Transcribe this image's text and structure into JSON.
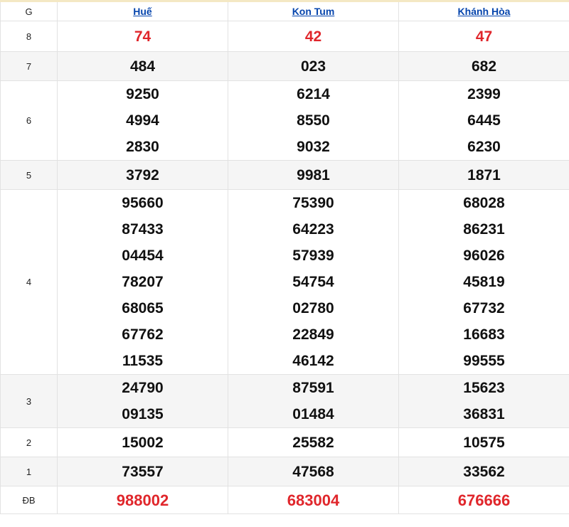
{
  "header": {
    "g_label": "G",
    "provinces": [
      "Huế",
      "Kon Tum",
      "Khánh Hòa"
    ]
  },
  "colors": {
    "accent_red": "#e0262b",
    "link_blue": "#0645ad",
    "alt_row_bg": "#f5f5f5",
    "top_border": "#f4e8c4"
  },
  "prizes": {
    "g8": {
      "label": "8",
      "values": [
        "74",
        "42",
        "47"
      ]
    },
    "g7": {
      "label": "7",
      "values": [
        "484",
        "023",
        "682"
      ]
    },
    "g6": {
      "label": "6",
      "values": [
        [
          "9250",
          "4994",
          "2830"
        ],
        [
          "6214",
          "8550",
          "9032"
        ],
        [
          "2399",
          "6445",
          "6230"
        ]
      ]
    },
    "g5": {
      "label": "5",
      "values": [
        "3792",
        "9981",
        "1871"
      ]
    },
    "g4": {
      "label": "4",
      "values": [
        [
          "95660",
          "87433",
          "04454",
          "78207",
          "68065",
          "67762",
          "11535"
        ],
        [
          "75390",
          "64223",
          "57939",
          "54754",
          "02780",
          "22849",
          "46142"
        ],
        [
          "68028",
          "86231",
          "96026",
          "45819",
          "67732",
          "16683",
          "99555"
        ]
      ]
    },
    "g3": {
      "label": "3",
      "values": [
        [
          "24790",
          "09135"
        ],
        [
          "87591",
          "01484"
        ],
        [
          "15623",
          "36831"
        ]
      ]
    },
    "g2": {
      "label": "2",
      "values": [
        "15002",
        "25582",
        "10575"
      ]
    },
    "g1": {
      "label": "1",
      "values": [
        "73557",
        "47568",
        "33562"
      ]
    },
    "db": {
      "label": "ĐB",
      "values": [
        "988002",
        "683004",
        "676666"
      ]
    }
  }
}
